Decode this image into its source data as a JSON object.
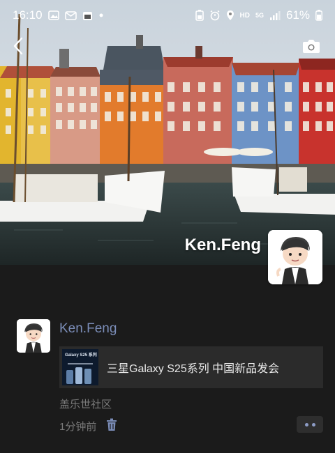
{
  "status": {
    "time": "16:10",
    "network": "HD",
    "net_gen": "5G",
    "battery": "61%"
  },
  "profile": {
    "name": "Ken.Feng"
  },
  "post": {
    "author": "Ken.Feng",
    "share_title": "三星Galaxy S25系列 中国新品发会",
    "thumb_text": "Galaxy S25 系列",
    "source": "盖乐世社区",
    "time": "1分钟前"
  },
  "colors": {
    "link": "#7b8db8",
    "background": "#1b1b1b",
    "card": "#2b2b2b"
  }
}
